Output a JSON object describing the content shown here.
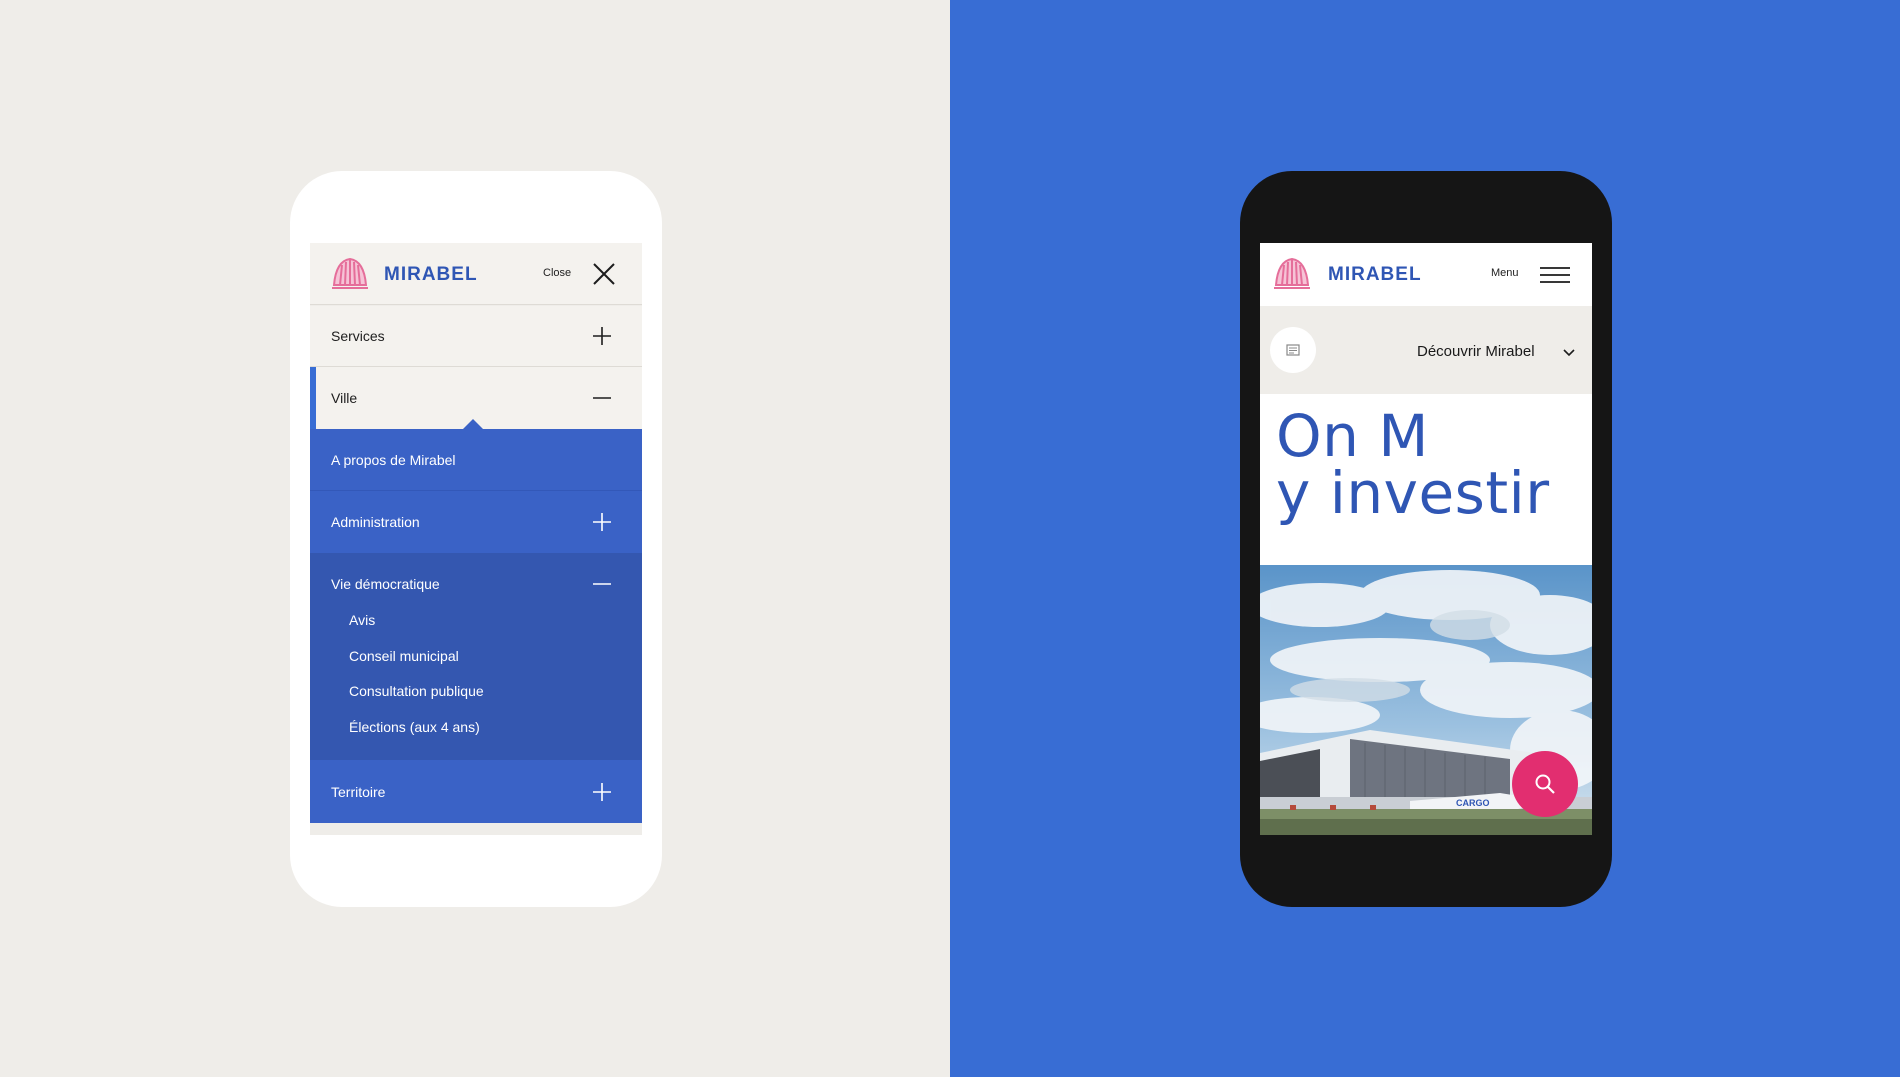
{
  "colors": {
    "left_background": "#efede9",
    "right_background": "#386dd4",
    "brand_blue": "#2f56b4",
    "menu_blue": "#3a62c6",
    "submenu_blue": "#3457b0",
    "logo_pink": "#e56e9a",
    "search_pink": "#e22e70"
  },
  "left_phone": {
    "logo_text": "MIRABEL",
    "close_label": "Close",
    "close_icon": "close-x-icon",
    "menu": {
      "services": "Services",
      "ville": "Ville",
      "apropos": "A propos de Mirabel",
      "administration": "Administration",
      "vie_democratique": "Vie démocratique",
      "vie_items": [
        "Avis",
        "Conseil municipal",
        "Consultation publique",
        "Élections (aux 4 ans)"
      ],
      "territoire": "Territoire"
    }
  },
  "right_phone": {
    "logo_text": "MIRABEL",
    "menu_label": "Menu",
    "menu_icon": "hamburger-icon",
    "dropdown_label": "Découvrir Mirabel",
    "hero_line1": "On M",
    "hero_line2": "y investir",
    "photo_label": "CARGO",
    "search_icon": "search-icon"
  }
}
